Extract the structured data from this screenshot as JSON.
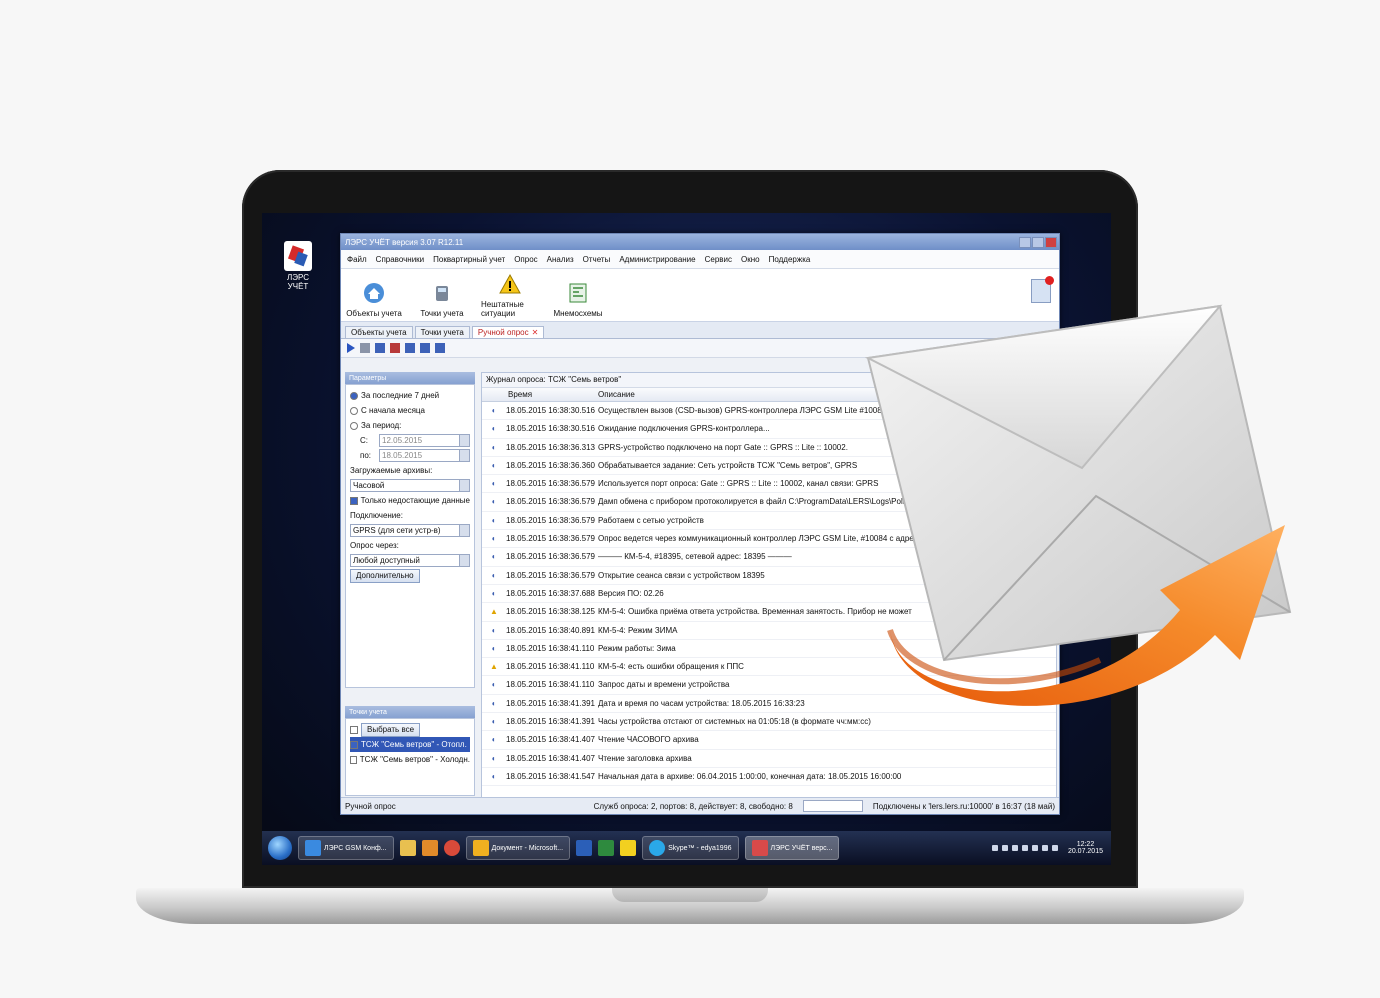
{
  "window": {
    "title": "ЛЭРС УЧЁТ версия 3.07 R12.11",
    "menu": [
      "Файл",
      "Справочники",
      "Поквартирный учет",
      "Опрос",
      "Анализ",
      "Отчеты",
      "Администрирование",
      "Сервис",
      "Окно",
      "Поддержка"
    ]
  },
  "toolbar": {
    "buttons": [
      {
        "label": "Объекты учета",
        "icon": "home-icon"
      },
      {
        "label": "Точки учета",
        "icon": "meter-icon"
      },
      {
        "label": "Нештатные ситуации",
        "icon": "warning-icon"
      },
      {
        "label": "Мнемосхемы",
        "icon": "diagram-icon"
      }
    ]
  },
  "tabs": [
    "Объекты учета",
    "Точки учета",
    "Ручной опрос"
  ],
  "params": {
    "header": "Параметры",
    "r1": "За последние 7 дней",
    "r2": "С начала месяца",
    "r3": "За период:",
    "from_label": "С:",
    "from_value": "12.05.2015",
    "to_label": "по:",
    "to_value": "18.05.2015",
    "archives_label": "Загружаемые архивы:",
    "archives_value": "Часовой",
    "missing_only": "Только недостающие данные",
    "connection_label": "Подключение:",
    "connection_value": "GPRS (для сети устр-в)",
    "via_label": "Опрос через:",
    "via_value": "Любой доступный",
    "more_button": "Дополнительно"
  },
  "points": {
    "header": "Точки учета",
    "select_all": "Выбрать все",
    "items": [
      "ТСЖ \"Семь ветров\" - Отопл.",
      "ТСЖ \"Семь ветров\" - Холодн."
    ]
  },
  "journal": {
    "title": "Журнал опроса: ТСЖ \"Семь ветров\"",
    "col_time": "Время",
    "col_desc": "Описание",
    "rows": [
      {
        "w": false,
        "time": "18.05.2015 16:38:30.516",
        "desc": "Осуществлен вызов (CSD-вызов) GPRS-контроллера ЛЭРС GSM Lite #10084 по"
      },
      {
        "w": false,
        "time": "18.05.2015 16:38:30.516",
        "desc": "Ожидание подключения GPRS-контроллера..."
      },
      {
        "w": false,
        "time": "18.05.2015 16:38:36.313",
        "desc": "GPRS-устройство подключено на порт Gate :: GPRS :: Lite :: 10002."
      },
      {
        "w": false,
        "time": "18.05.2015 16:38:36.360",
        "desc": "Обрабатывается задание: Сеть устройств ТСЖ \"Семь ветров\", GPRS"
      },
      {
        "w": false,
        "time": "18.05.2015 16:38:36.579",
        "desc": "Используется порт опроса: Gate :: GPRS :: Lite :: 10002, канал связи: GPRS"
      },
      {
        "w": false,
        "time": "18.05.2015 16:38:36.579",
        "desc": "Дамп обмена с прибором протоколируется в файл C:\\ProgramData\\LERS\\Logs\\PollService\\dump.Gate___GPRS___Lite___10002(172)"
      },
      {
        "w": false,
        "time": "18.05.2015 16:38:36.579",
        "desc": "Работаем с сетью устройств"
      },
      {
        "w": false,
        "time": "18.05.2015 16:38:36.579",
        "desc": "Опрос ведется через коммуникационный контроллер ЛЭРС GSM Lite, #10084 с адре"
      },
      {
        "w": false,
        "time": "18.05.2015 16:38:36.579",
        "desc": "——— КМ-5-4, #18395, сетевой адрес: 18395 ———"
      },
      {
        "w": false,
        "time": "18.05.2015 16:38:36.579",
        "desc": "Открытие сеанса связи с устройством 18395"
      },
      {
        "w": false,
        "time": "18.05.2015 16:38:37.688",
        "desc": "Версия ПО: 02.26"
      },
      {
        "w": true,
        "time": "18.05.2015 16:38:38.125",
        "desc": "КМ-5-4: Ошибка приёма ответа устройства. Временная занятость. Прибор не может"
      },
      {
        "w": false,
        "time": "18.05.2015 16:38:40.891",
        "desc": "КМ-5-4: Режим ЗИМА"
      },
      {
        "w": false,
        "time": "18.05.2015 16:38:41.110",
        "desc": "Режим работы: Зима"
      },
      {
        "w": true,
        "time": "18.05.2015 16:38:41.110",
        "desc": "КМ-5-4: есть ошибки обращения к ППС"
      },
      {
        "w": false,
        "time": "18.05.2015 16:38:41.110",
        "desc": "Запрос даты и времени устройства"
      },
      {
        "w": false,
        "time": "18.05.2015 16:38:41.391",
        "desc": "Дата и время по часам устройства: 18.05.2015 16:33:23"
      },
      {
        "w": false,
        "time": "18.05.2015 16:38:41.391",
        "desc": "Часы устройства отстают от системных на 01:05:18 (в формате чч:мм:сс)"
      },
      {
        "w": false,
        "time": "18.05.2015 16:38:41.407",
        "desc": "Чтение ЧАСОВОГО архива"
      },
      {
        "w": false,
        "time": "18.05.2015 16:38:41.407",
        "desc": "Чтение заголовка архива"
      },
      {
        "w": false,
        "time": "18.05.2015 16:38:41.547",
        "desc": "Начальная дата в архиве: 06.04.2015 1:00:00, конечная дата: 18.05.2015 16:00:00"
      }
    ]
  },
  "status": {
    "left": "Ручной опрос",
    "middle": "Служб опроса: 2, портов: 8, действует: 8, свободно: 8",
    "right": "Подключены к 'lers.lers.ru:10000' в 16:37 (18 май)"
  },
  "desktop": {
    "icon_label": "ЛЭРС УЧЁТ"
  },
  "taskbar": {
    "apps": [
      "ЛЭРС GSM Конф...",
      "Документ - Microsoft...",
      "Skype™ - edya1996",
      "ЛЭРС УЧЁТ верс..."
    ],
    "time": "12:22",
    "date": "20.07.2015"
  },
  "colors": {
    "accent": "#f07a1a",
    "window_title": "#6f8fc8",
    "selection": "#3157b6"
  }
}
